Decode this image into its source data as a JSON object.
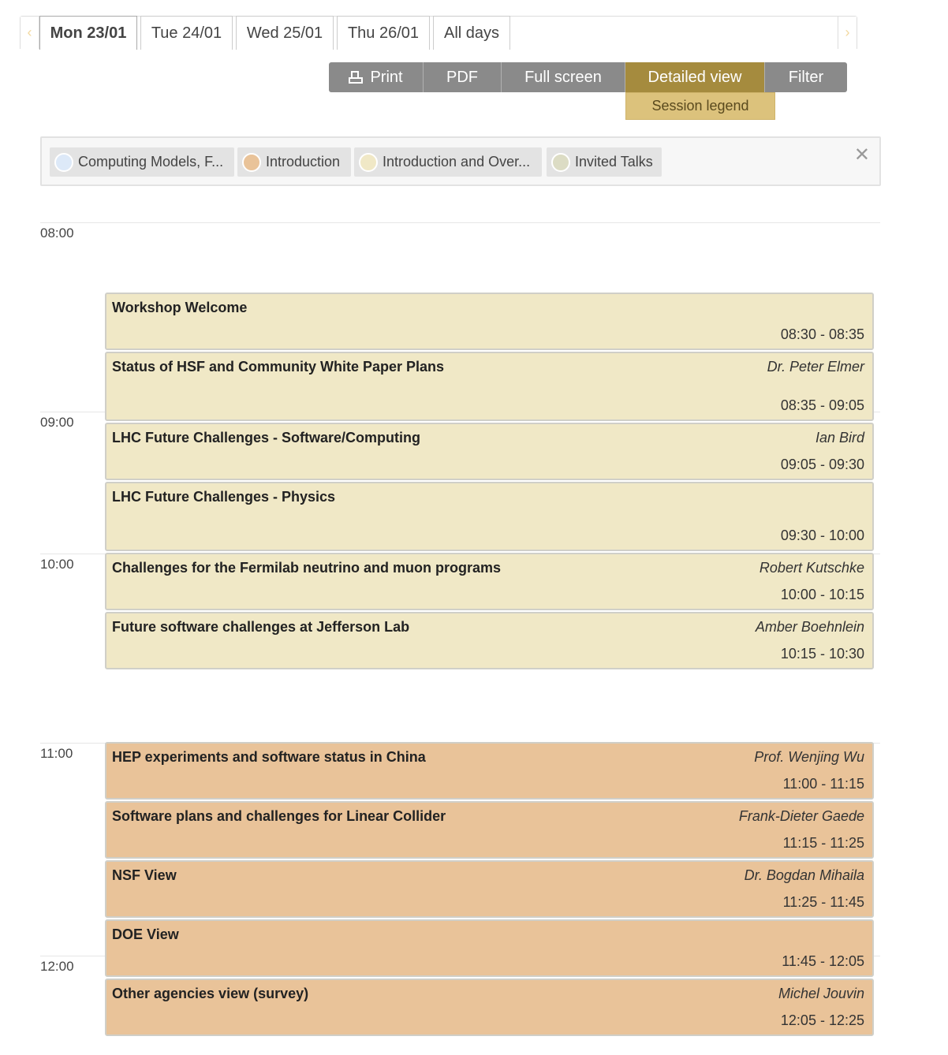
{
  "day_tabs": {
    "prev_arrow": "‹",
    "next_arrow": "›",
    "tabs": [
      {
        "label": "Mon 23/01"
      },
      {
        "label": "Tue 24/01"
      },
      {
        "label": "Wed 25/01"
      },
      {
        "label": "Thu 26/01"
      },
      {
        "label": "All days"
      }
    ]
  },
  "toolbar": {
    "print": "Print",
    "pdf": "PDF",
    "full_screen": "Full screen",
    "detailed_view": "Detailed view",
    "filter": "Filter",
    "session_legend": "Session legend"
  },
  "legend": {
    "close": "✕",
    "items": [
      {
        "label": "Computing Models, F...",
        "color": "#dde9f8"
      },
      {
        "label": "Introduction",
        "color": "#e9c399"
      },
      {
        "label": "Introduction and Over...",
        "color": "#f0e8c6"
      },
      {
        "label": "Invited Talks",
        "color": "#dcdcc4"
      }
    ]
  },
  "hours": [
    "08:00",
    "09:00",
    "10:00",
    "11:00",
    "12:00"
  ],
  "contributions": [
    {
      "title": "Workshop Welcome",
      "speaker": "",
      "time": "08:30 - 08:35",
      "session": "intro-overview"
    },
    {
      "title": "Status of HSF and Community White Paper Plans",
      "speaker": "Dr. Peter Elmer",
      "time": "08:35 - 09:05",
      "session": "intro-overview"
    },
    {
      "title": "LHC Future Challenges - Software/Computing",
      "speaker": "Ian Bird",
      "time": "09:05 - 09:30",
      "session": "intro-overview"
    },
    {
      "title": "LHC Future Challenges - Physics",
      "speaker": "",
      "time": "09:30 - 10:00",
      "session": "intro-overview"
    },
    {
      "title": "Challenges for the Fermilab neutrino and muon programs",
      "speaker": "Robert Kutschke",
      "time": "10:00 - 10:15",
      "session": "intro-overview"
    },
    {
      "title": "Future software challenges at Jefferson Lab",
      "speaker": "Amber Boehnlein",
      "time": "10:15 - 10:30",
      "session": "intro-overview"
    },
    {
      "title": "HEP experiments and software status in China",
      "speaker": "Prof. Wenjing Wu",
      "time": "11:00 - 11:15",
      "session": "introduction"
    },
    {
      "title": "Software plans and challenges for Linear Collider",
      "speaker": "Frank-Dieter Gaede",
      "time": "11:15 - 11:25",
      "session": "introduction"
    },
    {
      "title": "NSF View",
      "speaker": "Dr. Bogdan Mihaila",
      "time": "11:25 - 11:45",
      "session": "introduction"
    },
    {
      "title": "DOE View",
      "speaker": "",
      "time": "11:45 - 12:05",
      "session": "introduction"
    },
    {
      "title": "Other agencies view (survey)",
      "speaker": "Michel Jouvin",
      "time": "12:05 - 12:25",
      "session": "introduction"
    }
  ]
}
